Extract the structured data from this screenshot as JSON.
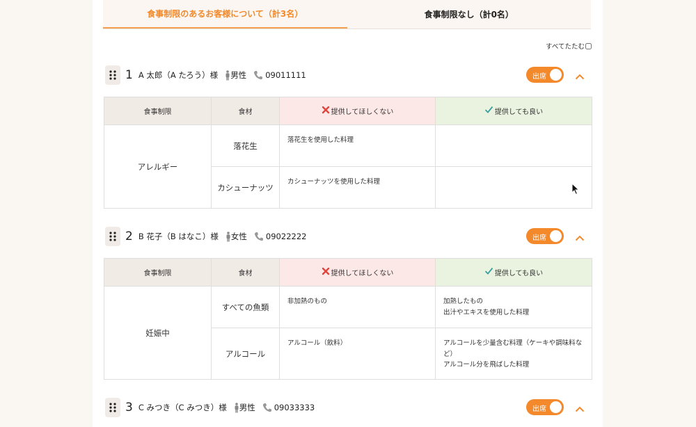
{
  "tabs": [
    {
      "label": "食事制限のあるお客様について（計3名）",
      "active": true
    },
    {
      "label": "食事制限なし（計0名）",
      "active": false
    }
  ],
  "collapse_all_label": "すべてたたむ",
  "table_headers": {
    "category": "食事制限",
    "food": "食材",
    "ng": "提供してほしくない",
    "ok": "提供しても良い"
  },
  "guests": [
    {
      "number": "1",
      "name": "A 太郎（A たろう）様",
      "gender": "男性",
      "phone": "09011111",
      "attend_label": "出席",
      "category": "アレルギー",
      "rows": [
        {
          "food": "落花生",
          "ng": [
            "落花生を使用した料理"
          ],
          "ok": []
        },
        {
          "food": "カシューナッツ",
          "ng": [
            "カシューナッツを使用した料理"
          ],
          "ok": []
        }
      ]
    },
    {
      "number": "2",
      "name": "B 花子（B はなこ）様",
      "gender": "女性",
      "phone": "09022222",
      "attend_label": "出席",
      "category": "妊娠中",
      "rows": [
        {
          "food": "すべての魚類",
          "ng": [
            "非加熱のもの"
          ],
          "ok": [
            "加熱したもの",
            "出汁やエキスを使用した料理"
          ]
        },
        {
          "food": "アルコール",
          "ng": [
            "アルコール（飲料）"
          ],
          "ok": [
            "アルコールを少量含む料理（ケーキや調味料など）",
            "アルコール分を飛ばした料理"
          ]
        }
      ]
    },
    {
      "number": "3",
      "name": "C みつき（C みつき）様",
      "gender": "男性",
      "phone": "09033333",
      "attend_label": "出席"
    }
  ],
  "colors": {
    "accent": "#f4892c",
    "ng_header_bg": "#fde8e8",
    "ok_header_bg": "#eaf3df",
    "ng_icon": "#e0443c",
    "ok_icon": "#3aa0a0"
  },
  "icons": {
    "drag": "drag-handle-icon",
    "person": "person-icon",
    "phone": "phone-icon",
    "chevron": "chevron-up-icon",
    "ng": "cross-icon",
    "ok": "check-icon"
  }
}
